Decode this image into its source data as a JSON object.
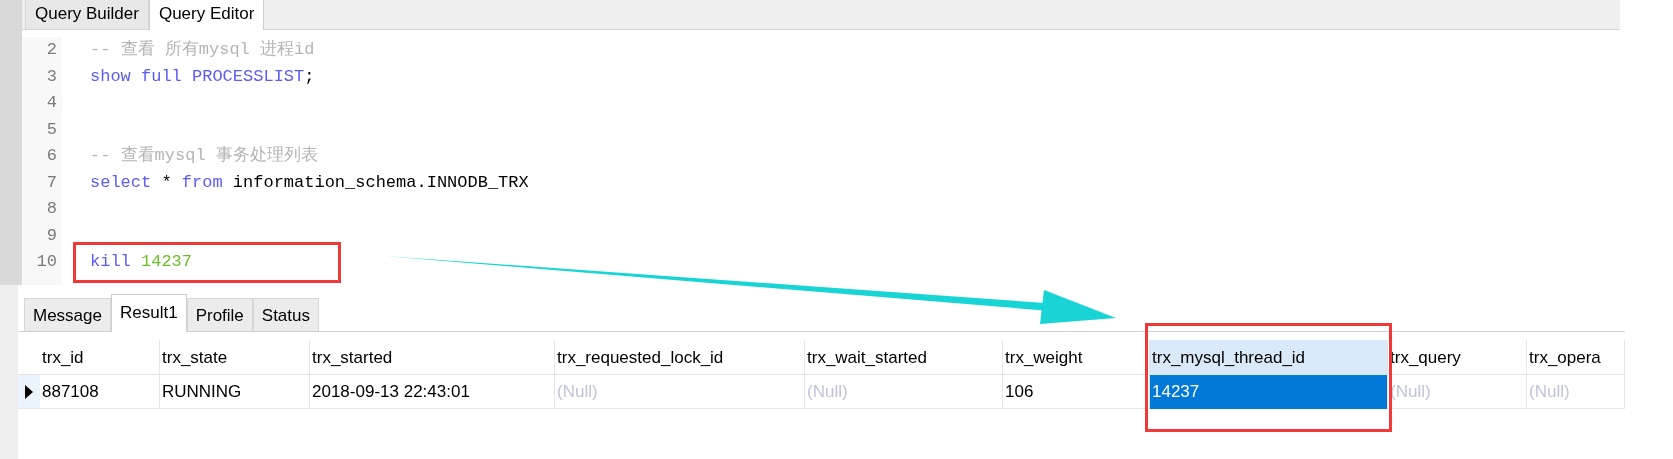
{
  "editor_tabs": [
    {
      "label": "Query Builder",
      "selected": false
    },
    {
      "label": "Query Editor",
      "selected": true
    }
  ],
  "editor_lines": [
    {
      "number": "2",
      "tokens": [
        {
          "kind": "comment",
          "text": "-- 查看 所有mysql 进程id"
        }
      ]
    },
    {
      "number": "3",
      "tokens": [
        {
          "kind": "keyword",
          "text": "show full PROCESSLIST"
        },
        {
          "kind": "plain",
          "text": ";"
        }
      ]
    },
    {
      "number": "4"
    },
    {
      "number": "5"
    },
    {
      "number": "6",
      "tokens": [
        {
          "kind": "comment",
          "text": "-- 查看mysql 事务处理列表"
        }
      ]
    },
    {
      "number": "7",
      "tokens": [
        {
          "kind": "keyword",
          "text": "select"
        },
        {
          "kind": "plain",
          "text": " * "
        },
        {
          "kind": "keyword",
          "text": "from"
        },
        {
          "kind": "plain",
          "text": " information_schema.INNODB_TRX"
        }
      ]
    },
    {
      "number": "8"
    },
    {
      "number": "9"
    },
    {
      "number": "10",
      "tokens": [
        {
          "kind": "keyword",
          "text": "kill"
        },
        {
          "kind": "number",
          "text": "14237"
        }
      ]
    }
  ],
  "result_tabs": [
    {
      "label": "Message",
      "selected": false
    },
    {
      "label": "Result1",
      "selected": true
    },
    {
      "label": "Profile",
      "selected": false
    },
    {
      "label": "Status",
      "selected": false
    }
  ],
  "table": {
    "columns": [
      {
        "label": "trx_id",
        "highlighted": false
      },
      {
        "label": "trx_state",
        "highlighted": false
      },
      {
        "label": "trx_started",
        "highlighted": false
      },
      {
        "label": "trx_requested_lock_id",
        "highlighted": false
      },
      {
        "label": "trx_wait_started",
        "highlighted": false
      },
      {
        "label": "trx_weight",
        "highlighted": false
      },
      {
        "label": "trx_mysql_thread_id",
        "highlighted": true
      },
      {
        "label": "trx_query",
        "highlighted": false
      },
      {
        "label": "trx_opera",
        "highlighted": false
      }
    ],
    "rows": [
      {
        "current": true,
        "cells": [
          {
            "text": "887108",
            "null": false,
            "selected": false
          },
          {
            "text": "RUNNING",
            "null": false,
            "selected": false
          },
          {
            "text": "2018-09-13 22:43:01",
            "null": false,
            "selected": false
          },
          {
            "text": "(Null)",
            "null": true,
            "selected": false
          },
          {
            "text": "(Null)",
            "null": true,
            "selected": false
          },
          {
            "text": "106",
            "null": false,
            "selected": false
          },
          {
            "text": "14237",
            "null": false,
            "selected": true
          },
          {
            "text": "(Null)",
            "null": true,
            "selected": false
          },
          {
            "text": "(Null)",
            "null": true,
            "selected": false
          }
        ]
      }
    ]
  }
}
